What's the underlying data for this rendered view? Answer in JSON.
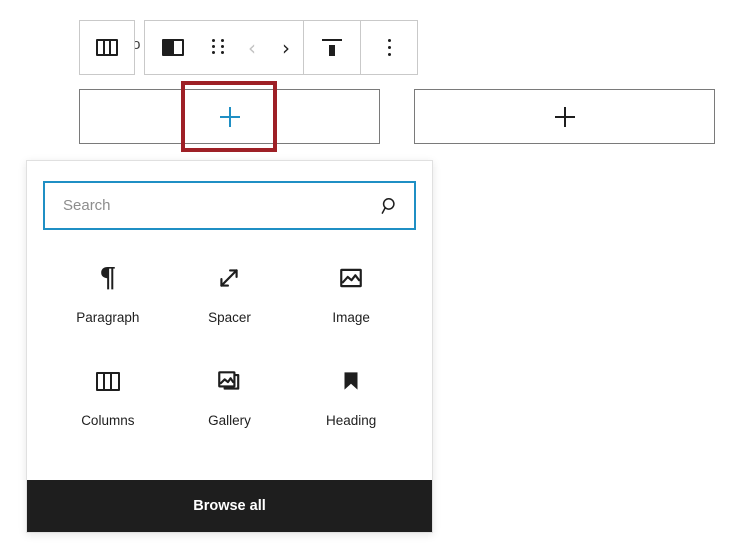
{
  "editor": {
    "hidden_paragraph_text": "to"
  },
  "toolbar": {
    "parent_button": {
      "label": "Select Columns",
      "icon": "columns-outline-icon"
    },
    "items": [
      {
        "label": "Column",
        "icon": "column-block-icon"
      },
      {
        "label": "Drag",
        "icon": "drag-handle-icon"
      },
      {
        "label": "Move left",
        "icon": "chevron-left-icon",
        "glyph": "‹",
        "state": "disabled"
      },
      {
        "label": "Move right",
        "icon": "chevron-right-icon",
        "glyph": "›",
        "state": "enabled"
      },
      {
        "label": "Change vertical alignment",
        "icon": "align-top-icon"
      },
      {
        "label": "Options",
        "icon": "kebab-menu-icon"
      }
    ]
  },
  "blocks": {
    "left_placeholder": {
      "name": "add-block-left",
      "icon": "plus-icon",
      "color": "#1f8fc4"
    },
    "right_placeholder": {
      "name": "add-block-right",
      "icon": "plus-icon",
      "color": "#1e1e1e"
    }
  },
  "annotation": {
    "highlight_color": "#9e2026"
  },
  "inserter": {
    "search": {
      "placeholder": "Search",
      "value": "",
      "icon": "search-icon",
      "focus_color": "#1f8fc4"
    },
    "blocks": [
      {
        "label": "Paragraph",
        "icon": "pilcrow-icon"
      },
      {
        "label": "Spacer",
        "icon": "resize-diagonal-icon"
      },
      {
        "label": "Image",
        "icon": "image-icon"
      },
      {
        "label": "Columns",
        "icon": "columns-icon"
      },
      {
        "label": "Gallery",
        "icon": "gallery-icon"
      },
      {
        "label": "Heading",
        "icon": "heading-bookmark-icon"
      }
    ],
    "browse_all_label": "Browse all"
  }
}
